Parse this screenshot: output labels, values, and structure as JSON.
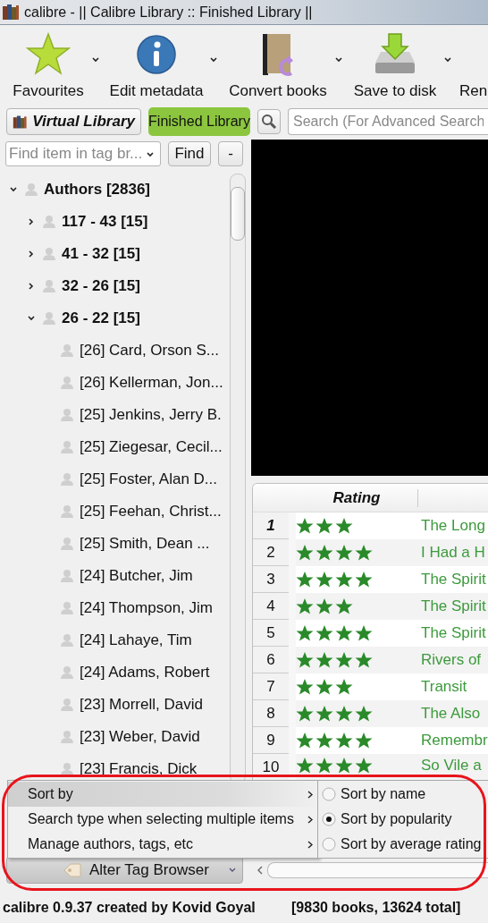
{
  "window": {
    "title": "calibre - || Calibre Library :: Finished Library ||"
  },
  "toolbar": {
    "actions": [
      {
        "kind": "star",
        "label": "Favourites",
        "dropdown": true
      },
      {
        "kind": "info",
        "label": "Edit metadata",
        "dropdown": true
      },
      {
        "kind": "book",
        "label": "Convert books",
        "dropdown": true
      },
      {
        "kind": "disk",
        "label": "Save to disk",
        "dropdown": true
      },
      {
        "kind": "text",
        "label": "Ren",
        "dropdown": false
      }
    ]
  },
  "library_bar": {
    "virtual_library": "Virtual Library",
    "current_library": "Finished Library",
    "search": {
      "placeholder": "Search (For Advanced Search"
    }
  },
  "tag_finder": {
    "placeholder": "Find item in tag br...",
    "find_button": "Find",
    "collapse_button": "-"
  },
  "tag_browser": {
    "tree": [
      {
        "label": "Authors [2836]",
        "expanded": true,
        "children": [
          {
            "label": "117 - 43 [15]",
            "expanded": false
          },
          {
            "label": "41 - 32 [15]",
            "expanded": false
          },
          {
            "label": "32 - 26 [15]",
            "expanded": false
          },
          {
            "label": "26 - 22 [15]",
            "expanded": true,
            "children": [
              {
                "label": "[26] Card, Orson S..."
              },
              {
                "label": "[26] Kellerman, Jon..."
              },
              {
                "label": "[25] Jenkins, Jerry B."
              },
              {
                "label": "[25] Ziegesar, Cecil..."
              },
              {
                "label": "[25] Foster, Alan D..."
              },
              {
                "label": "[25] Feehan, Christ..."
              },
              {
                "label": "[25] Smith, Dean ..."
              },
              {
                "label": "[24] Butcher, Jim"
              },
              {
                "label": "[24] Thompson, Jim"
              },
              {
                "label": "[24] Lahaye, Tim"
              },
              {
                "label": "[24] Adams, Robert"
              },
              {
                "label": "[23] Morrell, David"
              },
              {
                "label": "[23] Weber, David"
              },
              {
                "label": "[23] Francis, Dick"
              }
            ]
          }
        ]
      }
    ]
  },
  "alter_button": "Alter Tag Browser",
  "book_list": {
    "columns": [
      "Rating"
    ],
    "rows": [
      {
        "number": "1",
        "current": true,
        "stars": 3,
        "title": "The Long"
      },
      {
        "number": "2",
        "current": false,
        "stars": 4,
        "title": "I Had a H"
      },
      {
        "number": "3",
        "current": false,
        "stars": 4,
        "title": "The Spirit"
      },
      {
        "number": "4",
        "current": false,
        "stars": 3,
        "title": "The Spirit"
      },
      {
        "number": "5",
        "current": false,
        "stars": 4,
        "title": "The Spirit"
      },
      {
        "number": "6",
        "current": false,
        "stars": 4,
        "title": "Rivers of"
      },
      {
        "number": "7",
        "current": false,
        "stars": 3,
        "title": "Transit"
      },
      {
        "number": "8",
        "current": false,
        "stars": 4,
        "title": "The Also"
      },
      {
        "number": "9",
        "current": false,
        "stars": 4,
        "title": "Remembr"
      },
      {
        "number": "10",
        "current": false,
        "stars": 4,
        "title": "So Vile a"
      }
    ]
  },
  "context_menu": {
    "items": [
      {
        "label": "Sort by",
        "highlighted": true,
        "submenu": true
      },
      {
        "label": "Search type when selecting multiple items",
        "highlighted": false,
        "submenu": true
      },
      {
        "label": "Manage authors, tags, etc",
        "highlighted": false,
        "submenu": true
      }
    ],
    "submenu": [
      {
        "label": "Sort by name",
        "selected": false
      },
      {
        "label": "Sort by popularity",
        "selected": true
      },
      {
        "label": "Sort by average rating",
        "selected": false
      }
    ]
  },
  "status_bar": {
    "left": "calibre 0.9.37 created by Kovid Goyal",
    "right": "[9830 books, 13624 total]"
  }
}
